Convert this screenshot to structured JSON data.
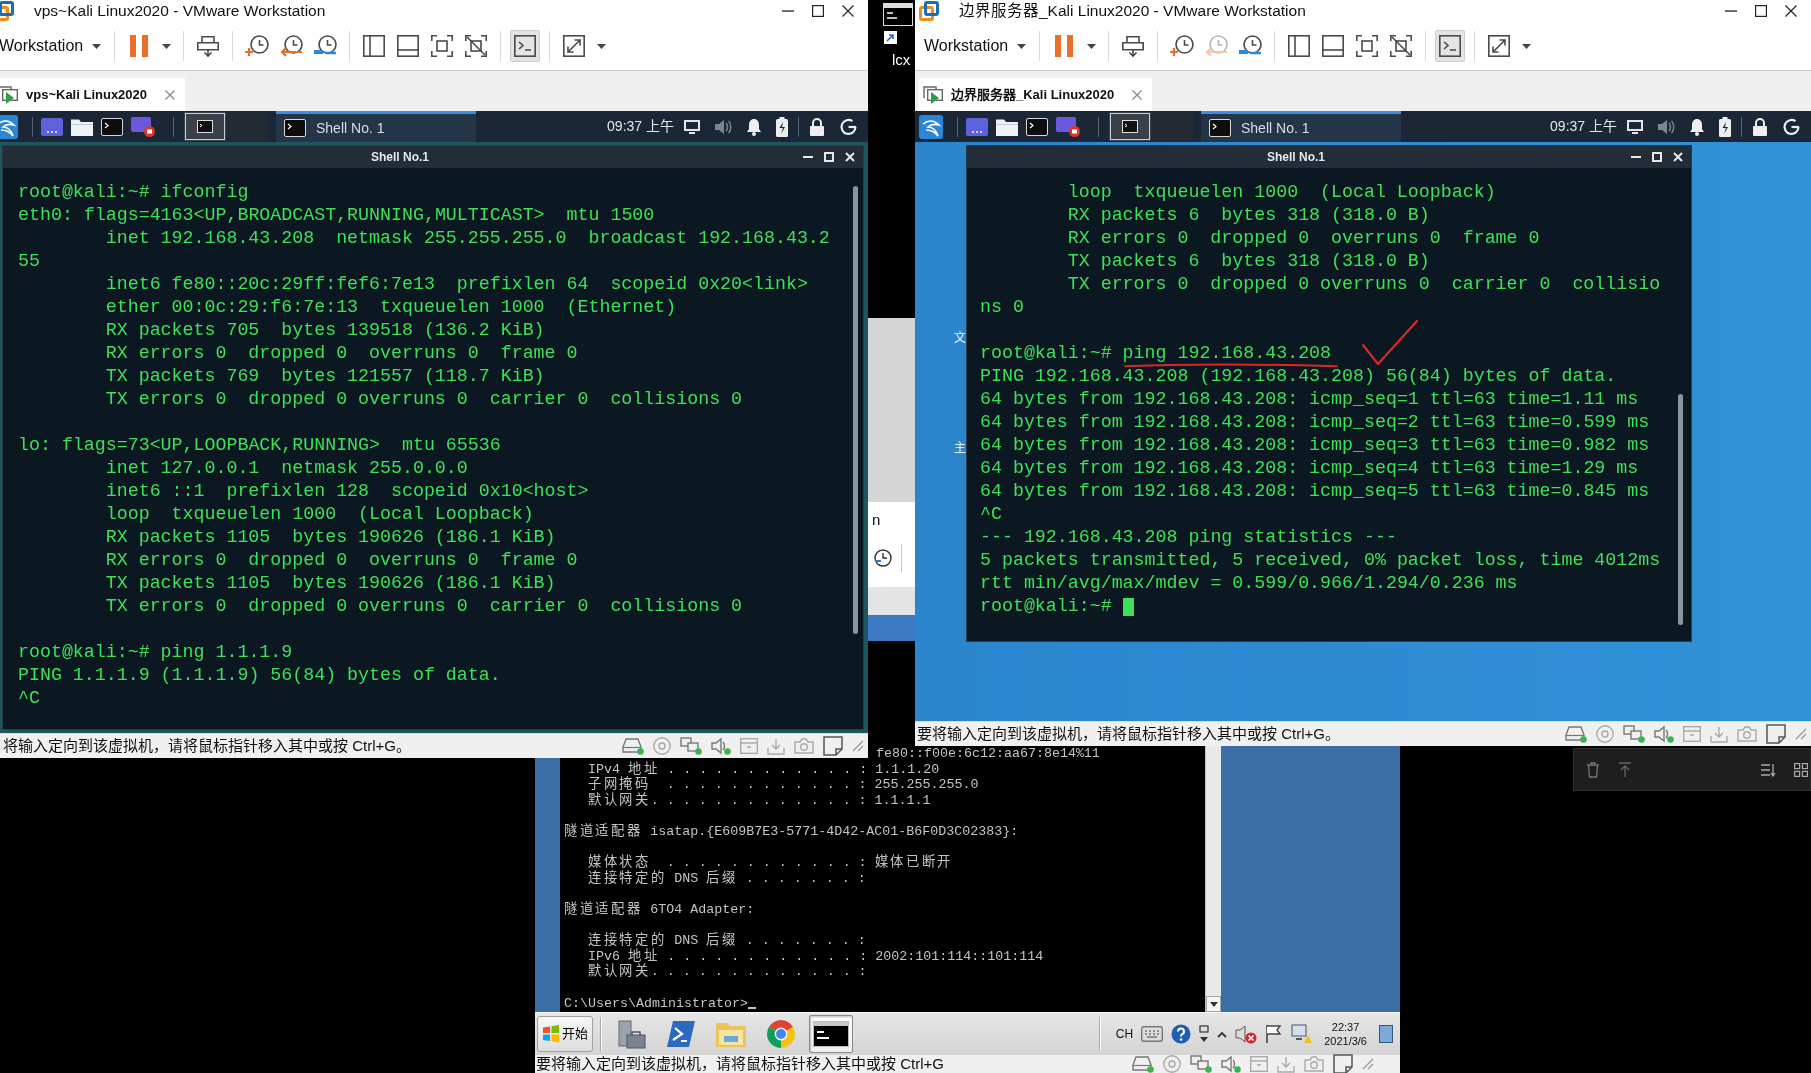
{
  "vm_windows": [
    {
      "title": "vps~Kali Linux2020 - VMware Workstation",
      "toolbar": {
        "menu": "Workstation",
        "revert_snapshot_enabled": true,
        "console_view_pressed": true
      },
      "tab": {
        "label": "vps~Kali Linux2020",
        "selected": true
      },
      "panel": {
        "workspaces": [
          {
            "selected": true
          },
          {
            "selected": false
          }
        ],
        "task": {
          "label": "Shell No. 1",
          "active": true
        },
        "clock": "09:37 上午"
      },
      "shell": {
        "title": "Shell No.1",
        "blocks": [
          [
            "root@kali:~# ifconfig",
            "eth0: flags=4163<UP,BROADCAST,RUNNING,MULTICAST>  mtu 1500",
            "        inet 192.168.43.208  netmask 255.255.255.0  broadcast 192.168.43.2",
            "55",
            "        inet6 fe80::20c:29ff:fef6:7e13  prefixlen 64  scopeid 0x20<link>",
            "        ether 00:0c:29:f6:7e:13  txqueuelen 1000  (Ethernet)",
            "        RX packets 705  bytes 139518 (136.2 KiB)",
            "        RX errors 0  dropped 0  overruns 0  frame 0",
            "        TX packets 769  bytes 121557 (118.7 KiB)",
            "        TX errors 0  dropped 0 overruns 0  carrier 0  collisions 0"
          ],
          [
            "lo: flags=73<UP,LOOPBACK,RUNNING>  mtu 65536",
            "        inet 127.0.0.1  netmask 255.0.0.0",
            "        inet6 ::1  prefixlen 128  scopeid 0x10<host>",
            "        loop  txqueuelen 1000  (Local Loopback)",
            "        RX packets 1105  bytes 190626 (186.1 KiB)",
            "        RX errors 0  dropped 0  overruns 0  frame 0",
            "        TX packets 1105  bytes 190626 (186.1 KiB)",
            "        TX errors 0  dropped 0 overruns 0  carrier 0  collisions 0"
          ],
          [
            "root@kali:~# ping 1.1.1.9",
            "PING 1.1.1.9 (1.1.1.9) 56(84) bytes of data.",
            "^C"
          ]
        ]
      },
      "status": "将输入定向到该虚拟机，请将鼠标指针移入其中或按 Ctrl+G。"
    },
    {
      "title": "边界服务器_Kali Linux2020 - VMware Workstation",
      "toolbar": {
        "menu": "Workstation",
        "revert_snapshot_enabled": false,
        "console_view_pressed": true
      },
      "tab": {
        "label": "边界服务器_Kali Linux2020",
        "selected": true
      },
      "panel": {
        "workspaces": [
          {
            "selected": true
          },
          {
            "selected": false
          }
        ],
        "task": {
          "label": "Shell No. 1",
          "active": true
        },
        "clock": "09:37 上午"
      },
      "desktop_labels": [
        "文",
        "主"
      ],
      "shell": {
        "title": "Shell No.1",
        "cursor": true,
        "blocks": [
          [
            "        loop  txqueuelen 1000  (Local Loopback)",
            "        RX packets 6  bytes 318 (318.0 B)",
            "        RX errors 0  dropped 0  overruns 0  frame 0",
            "        TX packets 6  bytes 318 (318.0 B)",
            "        TX errors 0  dropped 0 overruns 0  carrier 0  collisio",
            "ns 0"
          ],
          [
            "root@kali:~# ping 192.168.43.208",
            "PING 192.168.43.208 (192.168.43.208) 56(84) bytes of data.",
            "64 bytes from 192.168.43.208: icmp_seq=1 ttl=63 time=1.11 ms",
            "64 bytes from 192.168.43.208: icmp_seq=2 ttl=63 time=0.599 ms",
            "64 bytes from 192.168.43.208: icmp_seq=3 ttl=63 time=0.982 ms",
            "64 bytes from 192.168.43.208: icmp_seq=4 ttl=63 time=1.29 ms",
            "64 bytes from 192.168.43.208: icmp_seq=5 ttl=63 time=0.845 ms",
            "^C",
            "--- 192.168.43.208 ping statistics ---",
            "5 packets transmitted, 5 received, 0% packet loss, time 4012ms",
            "rtt min/avg/max/mdev = 0.599/0.966/1.294/0.236 ms",
            "root@kali:~#"
          ]
        ]
      },
      "annotations": [
        {
          "kind": "underline"
        },
        {
          "kind": "tick"
        }
      ],
      "status": "要将输入定向到该虚拟机，请将鼠标指针移入其中或按 Ctrl+G。"
    }
  ],
  "host_desktop": {
    "shortcut_label": "lcx",
    "window_fragment_text": "n"
  },
  "windows_vm": {
    "console": {
      "partly_hidden_line": "fe80::f00e:6c12:aa67:8e14%11",
      "blocks": [
        [
          "   IPv4 地址 . . . . . . . . . . . . : 1.1.1.20",
          "   子网掩码  . . . . . . . . . . . . : 255.255.255.0",
          "   默认网关. . . . . . . . . . . . . : 1.1.1.1"
        ],
        [
          "隧道适配器 isatap.{E609B7E3-5771-4D42-AC01-B6F0D3C02383}:"
        ],
        [
          "   媒体状态  . . . . . . . . . . . . : 媒体已断开",
          "   连接特定的 DNS 后缀 . . . . . . . :"
        ],
        [
          "隧道适配器 6TO4 Adapter:"
        ],
        [
          "   连接特定的 DNS 后缀 . . . . . . . :",
          "   IPv6 地址 . . . . . . . . . . . . : 2002:101:114::101:114",
          "   默认网关. . . . . . . . . . . . . :"
        ],
        [
          "C:\\Users\\Administrator>"
        ]
      ],
      "cursor": true
    },
    "taskbar": {
      "start": "开始",
      "apps": [
        {
          "kind": "server-manager",
          "active": false
        },
        {
          "kind": "powershell",
          "active": false
        },
        {
          "kind": "explorer",
          "active": false
        },
        {
          "kind": "browser",
          "active": false
        },
        {
          "kind": "console",
          "active": true
        }
      ],
      "language": "CH",
      "time": "22:37",
      "date": "2021/3/6"
    },
    "status": "要将输入定向到该虚拟机，请将鼠标指针移入其中或按 Ctrl+G"
  }
}
